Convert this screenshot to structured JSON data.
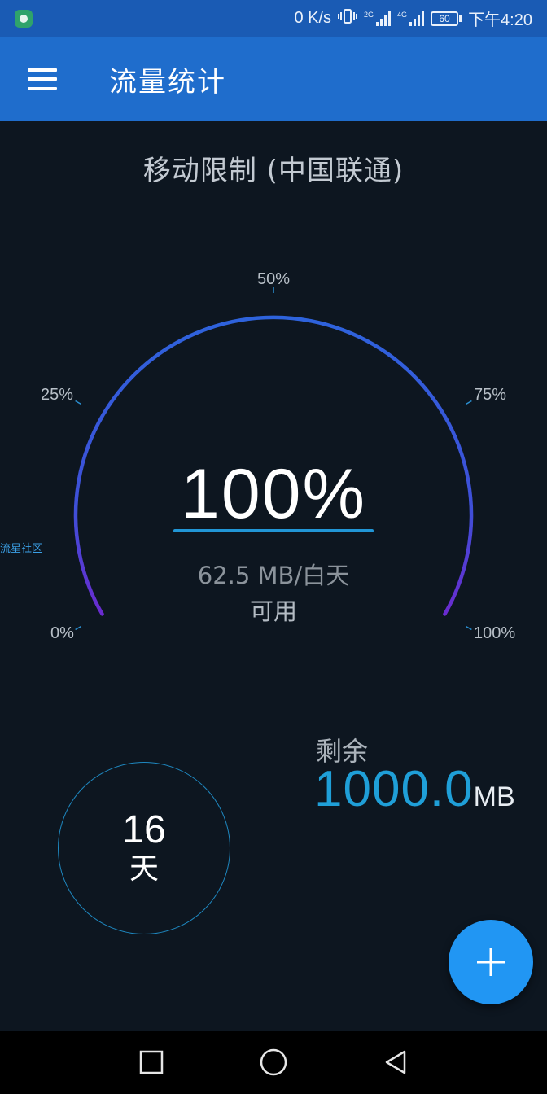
{
  "status_bar": {
    "net_speed": "0 K/s",
    "sim1_tag": "2G",
    "sim2_tag": "4G",
    "battery": "60",
    "time": "下午4:20"
  },
  "app_bar": {
    "title": "流量统计",
    "menu_icon": "hamburger-menu-icon"
  },
  "plan": {
    "title": "移动限制 (中国联通)"
  },
  "gauge": {
    "ticks": [
      "0%",
      "25%",
      "50%",
      "75%",
      "100%"
    ],
    "percent_text": "100%",
    "fill_fraction": 1.0,
    "daily_text": "62.5 MB/白天",
    "available_label": "可用",
    "arc_colors": [
      "#6a2bd0",
      "#2e63dc"
    ]
  },
  "side_link": "流星社区",
  "days": {
    "value": "16",
    "unit": "天"
  },
  "remaining": {
    "label": "剩余",
    "value": "1000.0",
    "unit": "MB"
  },
  "fab": {
    "icon": "plus-icon"
  },
  "nav": {
    "icons": [
      "recent-apps-square-icon",
      "home-circle-icon",
      "back-triangle-icon"
    ]
  },
  "colors": {
    "status_bar": "#1a5bb4",
    "app_bar": "#1f6dcc",
    "background": "#0d1620",
    "accent": "#1f9fd8",
    "fab": "#2196f3"
  }
}
